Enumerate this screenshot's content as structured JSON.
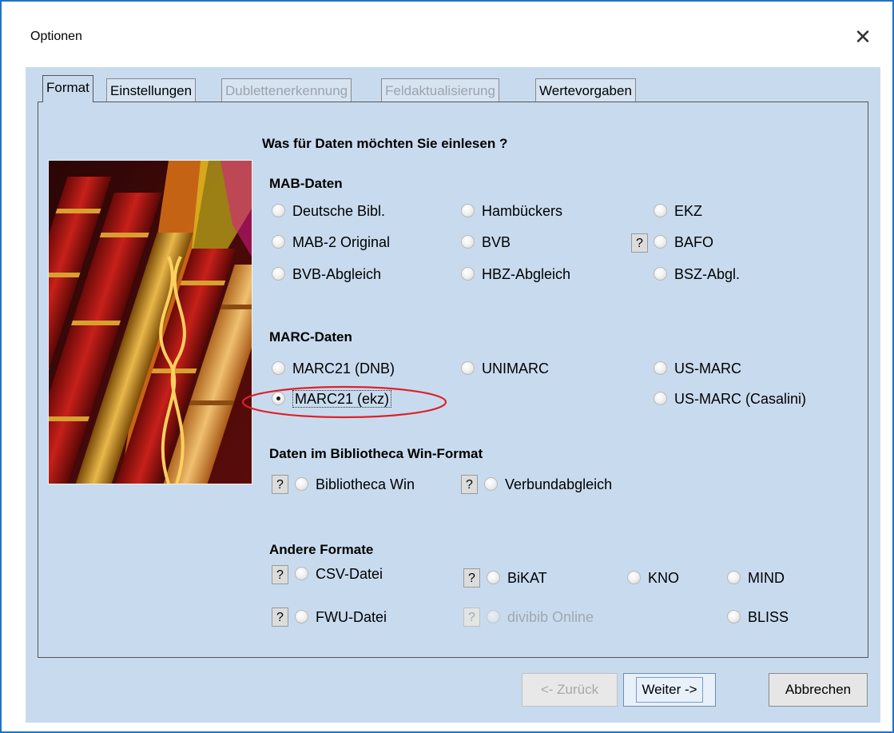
{
  "window": {
    "title": "Optionen",
    "close_glyph": "✕"
  },
  "tabs": [
    {
      "label": "Format",
      "state": "active"
    },
    {
      "label": "Einstellungen",
      "state": "normal"
    },
    {
      "label": "Dublettenerkennung",
      "state": "disabled"
    },
    {
      "label": "Feldaktualisierung",
      "state": "disabled"
    },
    {
      "label": "Wertevorgaben",
      "state": "normal"
    }
  ],
  "question": "Was für Daten möchten Sie einlesen ?",
  "groups": {
    "mab": {
      "title": "MAB-Daten",
      "options": [
        "Deutsche Bibl.",
        "Hambückers",
        "EKZ",
        "MAB-2 Original",
        "BVB",
        "BAFO",
        "BVB-Abgleich",
        "HBZ-Abgleich",
        "BSZ-Abgl."
      ]
    },
    "marc": {
      "title": "MARC-Daten",
      "options": [
        "MARC21 (DNB)",
        "UNIMARC",
        "US-MARC",
        "MARC21 (ekz)",
        "US-MARC (Casalini)"
      ],
      "selected": "MARC21 (ekz)"
    },
    "win": {
      "title": "Daten im Bibliotheca Win-Format",
      "options": [
        "Bibliotheca Win",
        "Verbundabgleich"
      ]
    },
    "other": {
      "title": "Andere Formate",
      "options": [
        "CSV-Datei",
        "BiKAT",
        "KNO",
        "MIND",
        "FWU-Datei",
        "divibib Online",
        "BLISS"
      ]
    }
  },
  "help_glyph": "?",
  "buttons": {
    "back": "<- Zurück",
    "next": "Weiter ->",
    "cancel": "Abbrechen"
  },
  "colors": {
    "window_border": "#1f73c8",
    "panel_bg": "#c8dbee",
    "highlight": "#e0202a"
  }
}
